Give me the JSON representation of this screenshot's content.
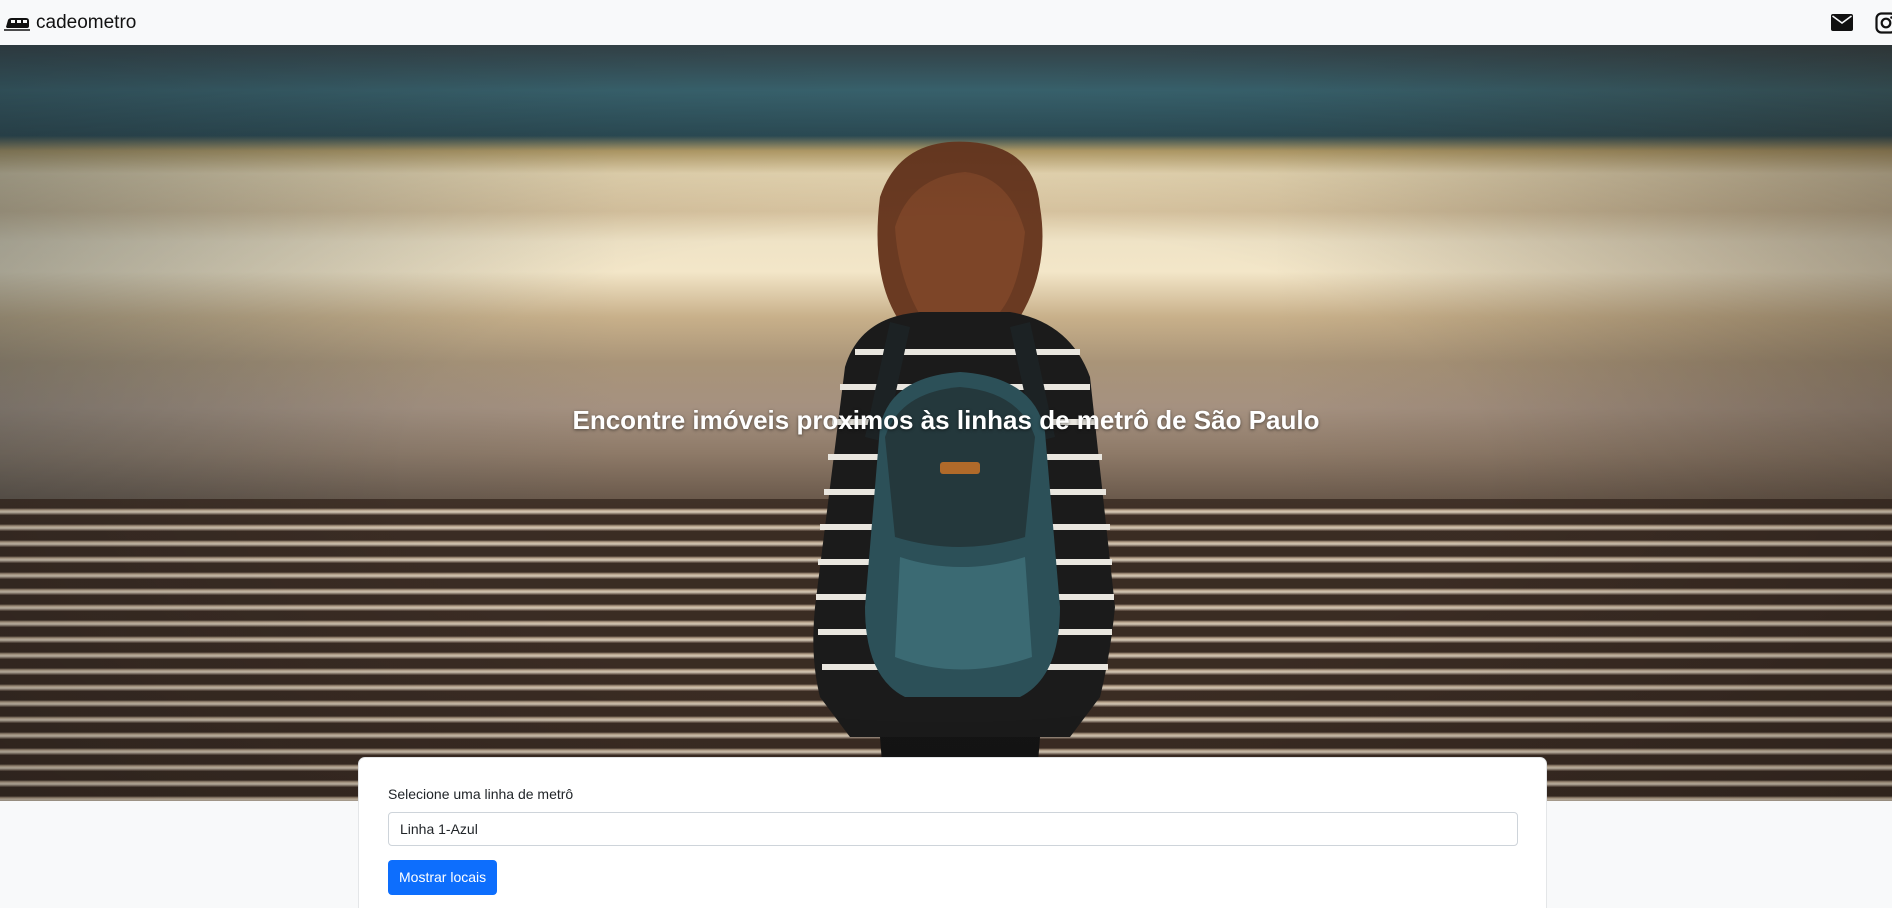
{
  "navbar": {
    "brand": "cadeometro",
    "icons": [
      "train-logo-icon",
      "envelope-icon",
      "instagram-icon"
    ]
  },
  "hero": {
    "title": "Encontre imóveis proximos às linhas de metrô de São Paulo"
  },
  "form": {
    "label": "Selecione uma linha de metrô",
    "selected_line": "Linha 1-Azul",
    "submit_label": "Mostrar locais"
  },
  "colors": {
    "primary": "#0d6efd",
    "navbar_bg": "#f8f9fa",
    "card_bg": "#ffffff"
  }
}
